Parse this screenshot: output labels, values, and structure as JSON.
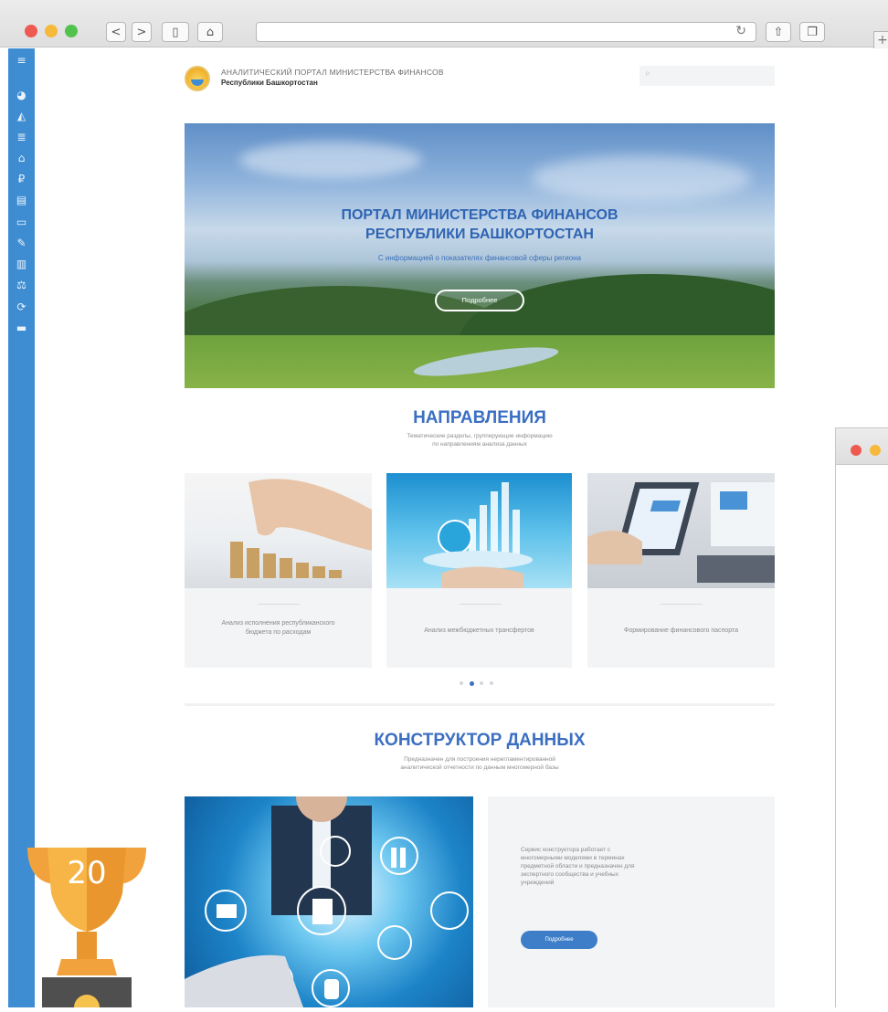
{
  "browser": {
    "buttons": {
      "back": "<",
      "forward": ">",
      "sidebar": "▯",
      "home": "⌂",
      "reload": "↻",
      "share": "⇧",
      "tabs": "❐",
      "new_tab": "+"
    },
    "url": ""
  },
  "sidebar": {
    "icons": [
      "menu-icon",
      "pie-chart-icon",
      "area-chart-icon",
      "database-icon",
      "bank-icon",
      "ruble-icon",
      "document-icon",
      "money-icon",
      "pencil-icon",
      "bar-chart-icon",
      "scales-icon",
      "refresh-icon",
      "card-icon"
    ],
    "color": "#3e8dd3"
  },
  "header": {
    "title": "АНАЛИТИЧЕСКИЙ ПОРТАЛ МИНИСТЕРСТВА ФИНАНСОВ",
    "subtitle": "Республики Башкортостан",
    "search_placeholder": ""
  },
  "hero": {
    "title_line1": "ПОРТАЛ МИНИСТЕРСТВА ФИНАНСОВ",
    "title_line2": "РЕСПУБЛИКИ БАШКОРТОСТАН",
    "subtitle": "С информацией о показателях финансовой сферы региона",
    "button": "Подробнее"
  },
  "directions": {
    "title": "НАПРАВЛЕНИЯ",
    "subtitle_line1": "Тематические разделы, группирующие информацию",
    "subtitle_line2": "по направлениям анализа данных",
    "cards": [
      {
        "text_line1": "Анализ исполнения республиканского",
        "text_line2": "бюджета по расходам"
      },
      {
        "text_line1": "Анализ межбюджетных трансфертов",
        "text_line2": ""
      },
      {
        "text_line1": "Формирование финансового паспорта",
        "text_line2": ""
      }
    ],
    "active_dot": 1
  },
  "builder": {
    "title": "КОНСТРУКТОР ДАННЫХ",
    "subtitle_line1": "Предназначен для построения нерегламентированной",
    "subtitle_line2": "аналитической отчетности по данным многомерной базы",
    "text_line1": "Сервис конструктора работает с",
    "text_line2": "многомерными моделями в терминах",
    "text_line3": "предметной области и предназначен для",
    "text_line4": "экспертного сообщества и учебных",
    "text_line5": "учреждений",
    "button": "Подробнее"
  },
  "trophy": {
    "number": "20"
  },
  "colors": {
    "accent": "#3b6fc2",
    "sidebar": "#3e8dd3",
    "panel": "#f3f4f6",
    "trophy": "#f1a23c"
  }
}
